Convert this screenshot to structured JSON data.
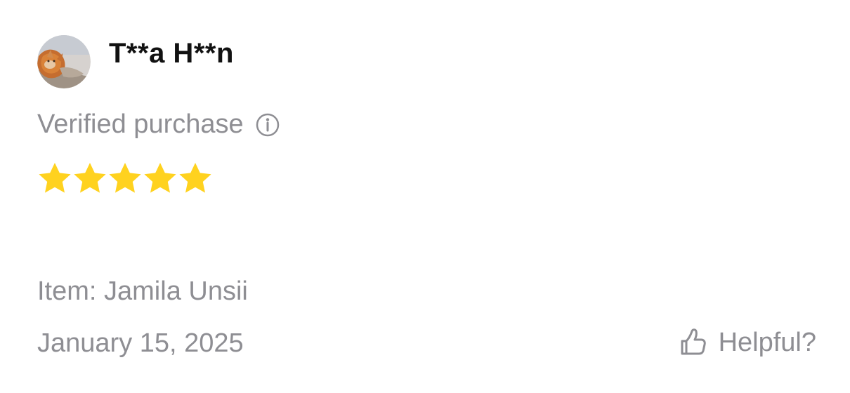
{
  "review": {
    "reviewer_name": "T**a H**n",
    "avatar_icon": "cat-avatar",
    "verified_label": "Verified purchase",
    "info_icon": "info-icon",
    "rating": 5,
    "rating_max": 5,
    "star_color": "#FFD21F",
    "item_label": "Item: Jamila Unsii",
    "date": "January 15, 2025",
    "helpful_label": "Helpful?",
    "helpful_icon": "thumbs-up-icon"
  }
}
